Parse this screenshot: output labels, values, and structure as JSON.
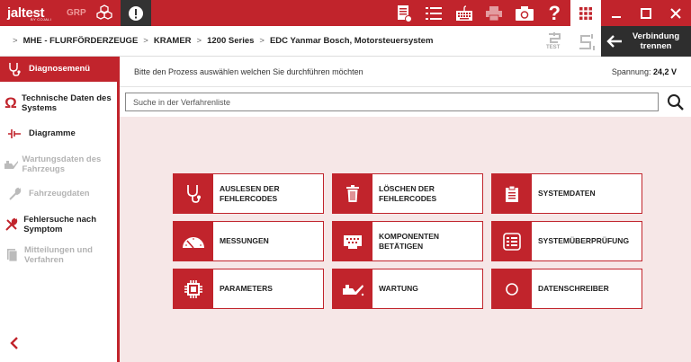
{
  "topbar": {
    "logo_text": "jaltest",
    "logo_sub": "BY COJALI",
    "grp_label": "GRP",
    "icons": [
      "cube-icon",
      "alert-icon",
      "document-icon",
      "list-icon",
      "keyboard-icon",
      "printer-icon",
      "camera-icon",
      "help-icon",
      "grid-icon",
      "minimize-icon",
      "maximize-icon",
      "close-icon"
    ],
    "help_glyph": "?"
  },
  "breadcrumb": {
    "items": [
      "MHE - FLURFÖRDERZEUGE",
      "KRAMER",
      "1200 Series",
      "EDC Yanmar Bosch, Motorsteuersystem"
    ],
    "separator": ">"
  },
  "toolbar": {
    "test_label": "TEST",
    "disconnect_label": "Verbindung trennen"
  },
  "sidebar": {
    "items": [
      {
        "label": "Diagnosemenü",
        "icon": "stethoscope-icon",
        "state": "active"
      },
      {
        "label": "Technische Daten des Systems",
        "icon": "ohm-icon",
        "state": "normal"
      },
      {
        "label": "Diagramme",
        "icon": "circuit-icon",
        "state": "normal"
      },
      {
        "label": "Wartungsdaten des Fahrzeugs",
        "icon": "oilcan-icon",
        "state": "disabled"
      },
      {
        "label": "Fahrzeugdaten",
        "icon": "wrench-icon",
        "state": "disabled"
      },
      {
        "label": "Fehlersuche nach Symptom",
        "icon": "tools-icon",
        "state": "normal"
      },
      {
        "label": "Mitteilungen und Verfahren",
        "icon": "documents-icon",
        "state": "disabled"
      }
    ],
    "collapse_icon": "chevron-left-icon"
  },
  "main": {
    "instruction": "Bitte den Prozess auswählen welchen Sie durchführen möchten",
    "voltage_label": "Spannung:",
    "voltage_value": "24,2 V",
    "search_placeholder": "Suche in der Verfahrenliste"
  },
  "tiles": [
    {
      "label": "AUSLESEN DER FEHLERCODES",
      "icon": "stethoscope-icon"
    },
    {
      "label": "LÖSCHEN DER FEHLERCODES",
      "icon": "trash-icon"
    },
    {
      "label": "SYSTEMDATEN",
      "icon": "clipboard-icon"
    },
    {
      "label": "MESSUNGEN",
      "icon": "gauge-icon"
    },
    {
      "label": "KOMPONENTEN BETÄTIGEN",
      "icon": "connector-icon"
    },
    {
      "label": "SYSTEMÜBERPRÜFUNG",
      "icon": "checklist-icon"
    },
    {
      "label": "PARAMETERS",
      "icon": "chip-icon"
    },
    {
      "label": "WARTUNG",
      "icon": "oilcan-icon"
    },
    {
      "label": "DATENSCHREIBER",
      "icon": "record-icon"
    }
  ],
  "colors": {
    "brand_red": "#c1242c",
    "dark": "#2e2e2e",
    "content_bg": "#f6e7e7"
  }
}
